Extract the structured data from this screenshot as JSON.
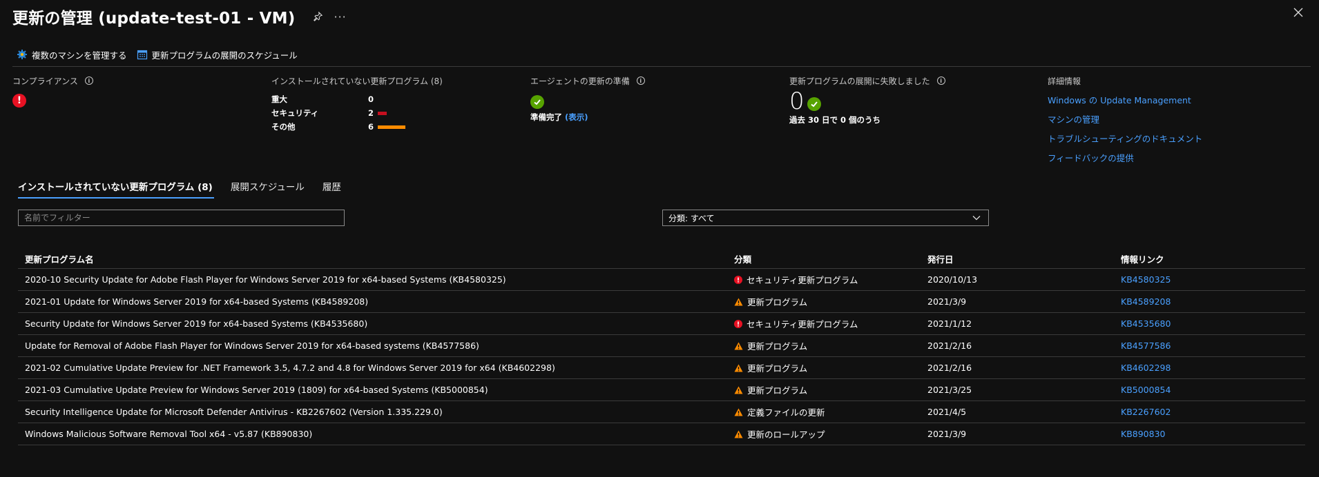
{
  "header": {
    "title": "更新の管理 (update-test-01 - VM)",
    "more": "···"
  },
  "toolbar": {
    "manage_label": "複数のマシンを管理する",
    "schedule_label": "更新プログラムの展開のスケジュール"
  },
  "compliance": {
    "title": "コンプライアンス"
  },
  "missing": {
    "title": "インストールされていない更新プログラム (8)",
    "rows": [
      {
        "label": "重大",
        "count": "0",
        "value": 0,
        "color": "#e81123"
      },
      {
        "label": "セキュリティ",
        "count": "2",
        "value": 2,
        "color": "#c50f1f"
      },
      {
        "label": "その他",
        "count": "6",
        "value": 6,
        "color": "#ff8c00"
      }
    ]
  },
  "agent": {
    "title": "エージェントの更新の準備",
    "status": "準備完了",
    "link": "(表示)"
  },
  "failed": {
    "title": "更新プログラムの展開に失敗しました",
    "count": "0",
    "subtitle": "過去 30 日で 0 個のうち"
  },
  "details": {
    "title": "詳細情報",
    "links": [
      "Windows の Update Management",
      "マシンの管理",
      "トラブルシューティングのドキュメント",
      "フィードバックの提供"
    ]
  },
  "tabs": [
    {
      "label": "インストールされていない更新プログラム (8)"
    },
    {
      "label": "展開スケジュール"
    },
    {
      "label": "履歴"
    }
  ],
  "filter": {
    "placeholder": "名前でフィルター"
  },
  "classification_select": {
    "value": "分類: すべて"
  },
  "table": {
    "headers": {
      "name": "更新プログラム名",
      "classification": "分類",
      "date": "発行日",
      "link": "情報リンク"
    },
    "rows": [
      {
        "name": "2020-10 Security Update for Adobe Flash Player for Windows Server 2019 for x64-based Systems (KB4580325)",
        "severity": "error",
        "classification": "セキュリティ更新プログラム",
        "date": "2020/10/13",
        "kb": "KB4580325"
      },
      {
        "name": "2021-01 Update for Windows Server 2019 for x64-based Systems (KB4589208)",
        "severity": "warning",
        "classification": "更新プログラム",
        "date": "2021/3/9",
        "kb": "KB4589208"
      },
      {
        "name": "Security Update for Windows Server 2019 for x64-based Systems (KB4535680)",
        "severity": "error",
        "classification": "セキュリティ更新プログラム",
        "date": "2021/1/12",
        "kb": "KB4535680"
      },
      {
        "name": "Update for Removal of Adobe Flash Player for Windows Server 2019 for x64-based systems (KB4577586)",
        "severity": "warning",
        "classification": "更新プログラム",
        "date": "2021/2/16",
        "kb": "KB4577586"
      },
      {
        "name": "2021-02 Cumulative Update Preview for .NET Framework 3.5, 4.7.2 and 4.8 for Windows Server 2019 for x64 (KB4602298)",
        "severity": "warning",
        "classification": "更新プログラム",
        "date": "2021/2/16",
        "kb": "KB4602298"
      },
      {
        "name": "2021-03 Cumulative Update Preview for Windows Server 2019 (1809) for x64-based Systems (KB5000854)",
        "severity": "warning",
        "classification": "更新プログラム",
        "date": "2021/3/25",
        "kb": "KB5000854"
      },
      {
        "name": "Security Intelligence Update for Microsoft Defender Antivirus - KB2267602 (Version 1.335.229.0)",
        "severity": "warning",
        "classification": "定義ファイルの更新",
        "date": "2021/4/5",
        "kb": "KB2267602"
      },
      {
        "name": "Windows Malicious Software Removal Tool x64 - v5.87 (KB890830)",
        "severity": "warning",
        "classification": "更新のロールアップ",
        "date": "2021/3/9",
        "kb": "KB890830"
      }
    ]
  }
}
